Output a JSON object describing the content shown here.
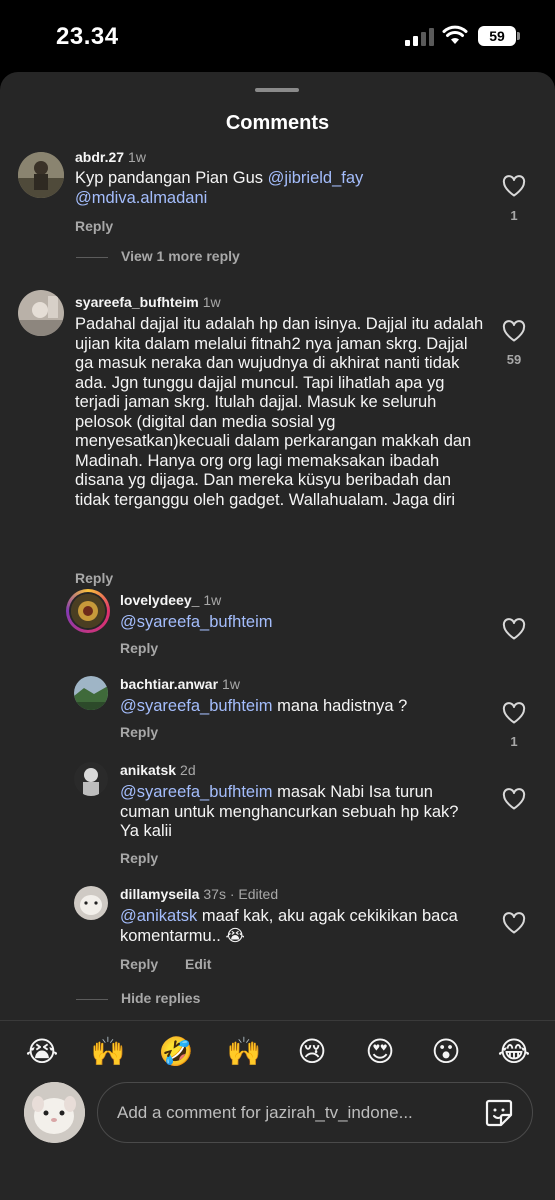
{
  "status_bar": {
    "time": "23.34",
    "battery": "59"
  },
  "sheet": {
    "title": "Comments"
  },
  "comments": [
    {
      "username": "abdr.27",
      "meta": "1w",
      "text_plain": "Kyp pandangan Pian Gus ",
      "mention1": "@jibrield_fay",
      "mention2": "@mdiva.almadani",
      "reply": "Reply",
      "likes": "1"
    },
    {
      "username": "syareefa_bufhteim",
      "meta": "1w",
      "text": "Padahal dajjal itu adalah hp dan isinya. Dajjal itu adalah ujian kita dalam melalui fitnah2 nya jaman skrg. Dajjal ga masuk neraka dan wujudnya di akhirat nanti tidak ada. Jgn tunggu dajjal muncul. Tapi lihatlah apa yg terjadi jaman skrg. Itulah dajjal. Masuk ke seluruh pelosok (digital dan media sosial yg menyesatkan)kecuali dalam perkarangan makkah dan Madinah. Hanya org org lagi memaksakan ibadah disana yg dijaga. Dan mereka küsyu beribadah dan tidak terganggu oleh gadget. Wallahualam. Jaga diri",
      "reply": "Reply",
      "likes": "59"
    }
  ],
  "view_more": "View 1 more reply",
  "replies": [
    {
      "username": "lovelydeey_",
      "meta": "1w",
      "mention": "@syareefa_bufhteim",
      "text": "",
      "reply": "Reply"
    },
    {
      "username": "bachtiar.anwar",
      "meta": "1w",
      "mention": "@syareefa_bufhteim",
      "text": " mana hadistnya ?",
      "reply": "Reply",
      "likes": "1"
    },
    {
      "username": "anikatsk",
      "meta": "2d",
      "mention": "@syareefa_bufhteim",
      "text": " masak Nabi Isa turun cuman untuk menghancurkan sebuah hp kak? Ya kalii",
      "reply": "Reply"
    },
    {
      "username": "dillamyseila",
      "meta": "37s · Edited",
      "mention": "@anikatsk",
      "text": " maaf kak, aku agak cekikikan baca komentarmu.. 😭",
      "reply": "Reply",
      "edit": "Edit"
    }
  ],
  "hide_replies": "Hide replies",
  "emoji_bar": [
    "😭",
    "🙌",
    "🤣",
    "🙌",
    "😢",
    "😍",
    "😮",
    "😂"
  ],
  "composer": {
    "placeholder": "Add a comment for jazirah_tv_indone..."
  },
  "icons": {
    "like": "heart-outline-icon",
    "sticker": "sticker-icon"
  },
  "colors": {
    "mention": "#a4bdfc",
    "secondary": "#a8a8a8",
    "sheet": "#262626"
  }
}
